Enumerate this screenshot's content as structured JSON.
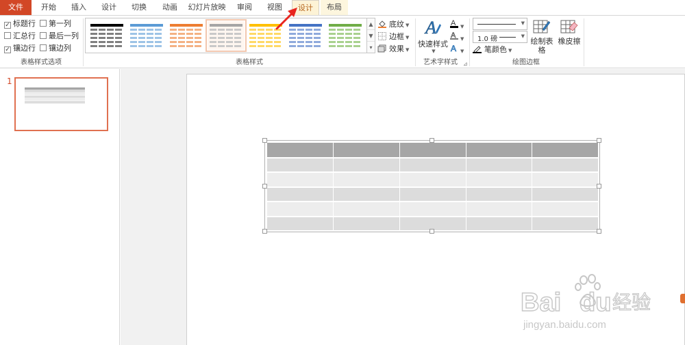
{
  "tabs": [
    {
      "label": "文件",
      "state": "file"
    },
    {
      "label": "开始",
      "state": "normal"
    },
    {
      "label": "插入",
      "state": "normal"
    },
    {
      "label": "设计",
      "state": "normal"
    },
    {
      "label": "切换",
      "state": "normal"
    },
    {
      "label": "动画",
      "state": "normal"
    },
    {
      "label": "幻灯片放映",
      "state": "normal"
    },
    {
      "label": "审阅",
      "state": "normal"
    },
    {
      "label": "视图",
      "state": "normal"
    },
    {
      "label": "设计",
      "state": "active"
    },
    {
      "label": "布局",
      "state": "context"
    }
  ],
  "style_options": {
    "label": "表格样式选项",
    "options": [
      {
        "label": "标题行",
        "checked": true
      },
      {
        "label": "第一列",
        "checked": false
      },
      {
        "label": "汇总行",
        "checked": false
      },
      {
        "label": "最后一列",
        "checked": false
      },
      {
        "label": "镶边行",
        "checked": true
      },
      {
        "label": "镶边列",
        "checked": false
      }
    ]
  },
  "table_styles": {
    "label": "表格样式",
    "thumbs": [
      {
        "color": "#000000",
        "band": "#7f7f7f"
      },
      {
        "color": "#5b9bd5",
        "band": "#9dc3e6"
      },
      {
        "color": "#ed7d31",
        "band": "#f4b183"
      },
      {
        "color": "#a5a5a5",
        "band": "#c9c9c9",
        "selected": true
      },
      {
        "color": "#ffc000",
        "band": "#ffd966"
      },
      {
        "color": "#4472c4",
        "band": "#8faadc"
      },
      {
        "color": "#70ad47",
        "band": "#a9d18e"
      }
    ],
    "shading": "底纹",
    "borders": "边框",
    "effects": "效果"
  },
  "wordart": {
    "label": "艺术字样式",
    "quick_styles": "快速样式"
  },
  "draw_borders": {
    "label": "绘图边框",
    "pen_weight": "1.0 磅",
    "pen_color": "笔颜色",
    "draw_table": "绘制表格",
    "eraser": "橡皮擦"
  },
  "slide_panel": {
    "slide_number": "1"
  },
  "table": {
    "columns": 5,
    "rows": 6,
    "header_color": "#a6a6a6",
    "band_color_a": "#dcdcdc",
    "band_color_b": "#ededed"
  },
  "watermark": {
    "brand": "Bai",
    "brand2": "du",
    "site_cn": "经验",
    "url": "jingyan.baidu.com"
  }
}
